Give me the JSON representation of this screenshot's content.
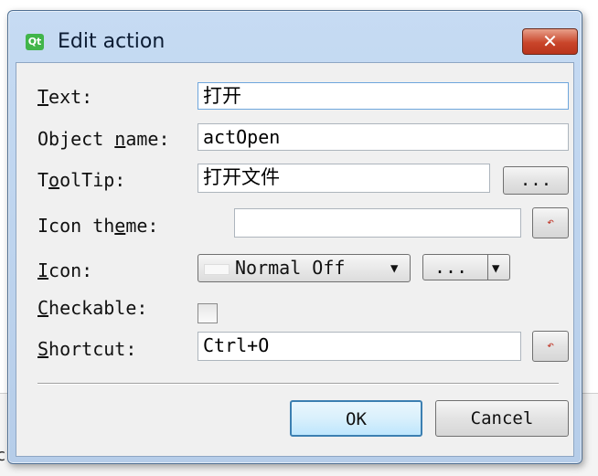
{
  "dialog": {
    "title": "Edit action",
    "app_icon_text": "Qt",
    "close_label": "✕"
  },
  "form": {
    "text": {
      "label_pre": "",
      "label_u": "T",
      "label_post": "ext:",
      "value": "打开"
    },
    "object_name": {
      "label_pre": "Object ",
      "label_u": "n",
      "label_post": "ame:",
      "value": "actOpen"
    },
    "tooltip": {
      "label_pre": "T",
      "label_u": "o",
      "label_post": "olTip:",
      "value": "打开文件",
      "button": "..."
    },
    "icon_theme": {
      "label_pre": "Icon th",
      "label_u": "e",
      "label_post": "me:",
      "value": "",
      "reset_glyph": "↶"
    },
    "icon": {
      "label_pre": "",
      "label_u": "I",
      "label_post": "con:",
      "state": "Normal Off",
      "state_arrow": "▼",
      "browse": "...",
      "browse_arrow": "▼"
    },
    "checkable": {
      "label_pre": "",
      "label_u": "C",
      "label_post": "heckable:",
      "checked": false
    },
    "shortcut": {
      "label_pre": "",
      "label_u": "S",
      "label_post": "hortcut:",
      "value": "Ctrl+O",
      "reset_glyph": "↶"
    }
  },
  "buttons": {
    "ok": "OK",
    "cancel": "Cancel"
  }
}
